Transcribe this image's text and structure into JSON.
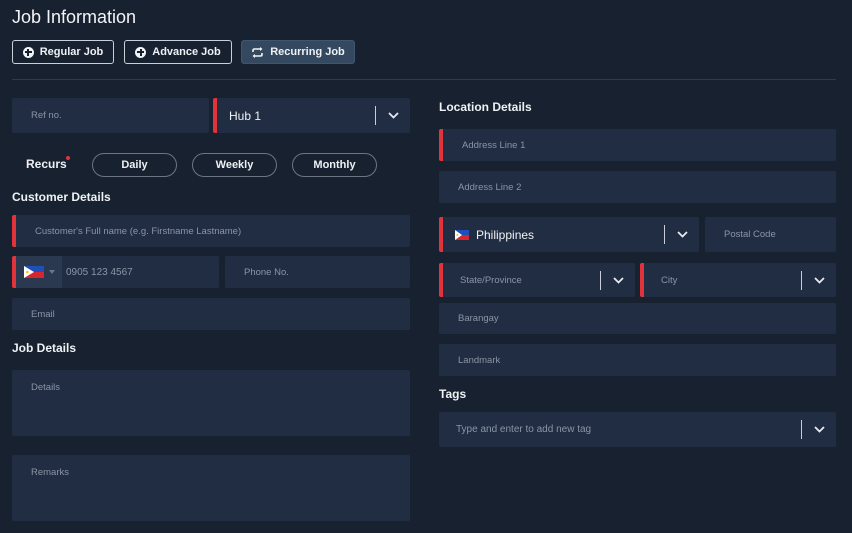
{
  "header": {
    "title": "Job Information"
  },
  "job_types": [
    {
      "label": "Regular Job",
      "icon": "plus-circle-icon"
    },
    {
      "label": "Advance Job",
      "icon": "plus-circle-icon"
    },
    {
      "label": "Recurring Job",
      "icon": "repeat-icon",
      "active": true
    }
  ],
  "form": {
    "ref_placeholder": "Ref no.",
    "hub": {
      "value": "Hub 1"
    },
    "recurs": {
      "label": "Recurs",
      "options": [
        "Daily",
        "Weekly",
        "Monthly"
      ]
    },
    "customer": {
      "heading": "Customer Details",
      "fullname_placeholder": "Customer's Full name (e.g. Firstname Lastname)",
      "mobile_placeholder": "0905 123 4567",
      "phone_placeholder": "Phone No.",
      "email_placeholder": "Email"
    },
    "job": {
      "heading": "Job Details",
      "details_placeholder": "Details",
      "remarks_placeholder": "Remarks"
    },
    "location": {
      "heading": "Location Details",
      "address1_placeholder": "Address Line 1",
      "address2_placeholder": "Address Line 2",
      "country": "Philippines",
      "postal_placeholder": "Postal Code",
      "state_placeholder": "State/Province",
      "city_placeholder": "City",
      "barangay_placeholder": "Barangay",
      "landmark_placeholder": "Landmark"
    },
    "tags": {
      "heading": "Tags",
      "placeholder": "Type and enter to add new tag"
    }
  },
  "colors": {
    "background": "#18212f",
    "field": "#212d42",
    "required_accent": "#e0333b",
    "active_button": "#34495f"
  }
}
